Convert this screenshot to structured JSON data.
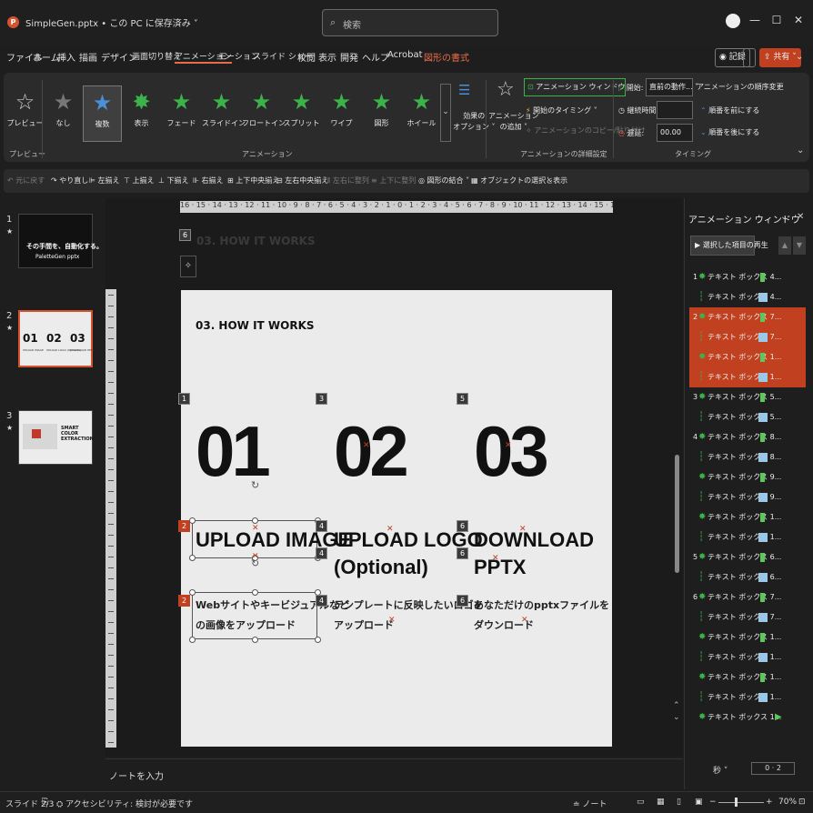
{
  "titlebar": {
    "filename": "SimpleGen.pptx",
    "save_status": "• この PC に保存済み ˅",
    "search_placeholder": "検索",
    "app_icon": "powerpoint-icon",
    "minimize": "—",
    "maximize": "☐",
    "close": "✕"
  },
  "menu": {
    "items": [
      "ファイル",
      "ホーム",
      "挿入",
      "描画",
      "デザイン",
      "画面切り替え",
      "アニメーション",
      "モーション",
      "スライド ショー",
      "校閲",
      "表示",
      "開発",
      "ヘルプ",
      "Acrobat",
      "図形の書式"
    ],
    "active_index": 6,
    "record": "記録",
    "share": "共有 ˅"
  },
  "ribbon": {
    "preview_label": "プレビュー",
    "preview_group": "プレビュー",
    "effects": [
      "なし",
      "複数",
      "表示",
      "フェード",
      "スライドイン",
      "フロートイン",
      "スプリット",
      "ワイプ",
      "図形",
      "ホイール"
    ],
    "selected_effect_index": 1,
    "animation_group": "アニメーション",
    "effect_options": "効果の\nオプション ˅",
    "add_animation": "アニメーション\nの追加 ˅",
    "animation_pane": "アニメーション ウィンドウ",
    "trigger": "開始のタイミング ˅",
    "painter": "アニメーションのコピー/貼り付け",
    "advanced_group": "アニメーションの詳細設定",
    "start_label": "開始:",
    "start_value": "直前の動作... ˅",
    "duration_label": "継続時間:",
    "duration_value": "",
    "delay_label": "遅延:",
    "delay_value": "00.00",
    "timing_group": "タイミング",
    "reorder_title": "アニメーションの順序変更",
    "move_earlier": "順番を前にする",
    "move_later": "順番を後にする"
  },
  "qat": {
    "items": [
      "元に戻す",
      "やり直し",
      "左揃え",
      "上揃え",
      "下揃え",
      "右揃え",
      "上下中央揃え",
      "左右中央揃え",
      "左右に整列",
      "上下に整列",
      "図形の結合 ˅",
      "オブジェクトの選択と表示"
    ],
    "disabled": [
      0,
      8,
      9
    ]
  },
  "thumbnails": [
    {
      "num": "1",
      "star": "★",
      "heading": "その手間を、自動化する。",
      "sub": "PaletteGen pptx"
    },
    {
      "num": "2",
      "star": "★",
      "cols": [
        "01",
        "02",
        "03"
      ],
      "captions": [
        "UPLOAD IMAGE",
        "UPLOAD LOGO (Optional)",
        "DOWNLOAD PPTX"
      ]
    },
    {
      "num": "3",
      "star": "★",
      "heading": "SMART COLOR EXTRACTION"
    }
  ],
  "ruler_ticks": "16 · 15 · 14 · 13 · 12 · 11 · 10 · 9 · 8 · 7 · 6 · 5 · 4 · 3 · 2 · 1 · 0 · 1 · 2 · 3 · 4 · 5 · 6 · 7 · 8 · 9 · 10 · 11 · 12 · 13 · 14 · 15 · 16",
  "offslide_title": "03. HOW IT WORKS",
  "offslide_tag": "6",
  "slide": {
    "title": "03. HOW IT WORKS",
    "columns": [
      {
        "num": "01",
        "heading1": "UPLOAD IMAGE",
        "heading2": "",
        "desc1": "Webサイトやキービジュアルなど",
        "desc2": "の画像をアップロード",
        "tag_num": "1",
        "tag_head": "2",
        "tag_desc": "2"
      },
      {
        "num": "02",
        "heading1": "UPLOAD LOGO",
        "heading2": "(Optional)",
        "desc1": "テンプレートに反映したいロゴを",
        "desc2": "アップロード",
        "tag_num": "3",
        "tag_head": "4",
        "tag_desc": "4"
      },
      {
        "num": "03",
        "heading1": "DOWNLOAD",
        "heading2": "PPTX",
        "desc1": "あなただけのpptxファイルを",
        "desc2": "ダウンロード",
        "tag_num": "5",
        "tag_head": "6",
        "tag_desc": "6"
      }
    ]
  },
  "notes_placeholder": "ノートを入力",
  "anim_pane": {
    "title": "アニメーション ウィンドウ",
    "play_button": "選択した項目の再生",
    "rows": [
      {
        "n": "1",
        "text": "テキスト ボックス 4...",
        "kind": "bar"
      },
      {
        "n": "",
        "text": "テキスト ボックス 4...",
        "kind": "box"
      },
      {
        "n": "2",
        "text": "テキスト ボックス 7...",
        "kind": "bar"
      },
      {
        "n": "",
        "text": "テキスト ボックス 7...",
        "kind": "box"
      },
      {
        "n": "",
        "text": "テキスト ボックス 1...",
        "kind": "bar"
      },
      {
        "n": "",
        "text": "テキスト ボックス 1...",
        "kind": "box"
      },
      {
        "n": "3",
        "text": "テキスト ボックス 5...",
        "kind": "bar"
      },
      {
        "n": "",
        "text": "テキスト ボックス 5...",
        "kind": "box"
      },
      {
        "n": "4",
        "text": "テキスト ボックス 8...",
        "kind": "bar"
      },
      {
        "n": "",
        "text": "テキスト ボックス 8...",
        "kind": "box"
      },
      {
        "n": "",
        "text": "テキスト ボックス 9...",
        "kind": "bar"
      },
      {
        "n": "",
        "text": "テキスト ボックス 9...",
        "kind": "box"
      },
      {
        "n": "",
        "text": "テキスト ボックス 1...",
        "kind": "bar"
      },
      {
        "n": "",
        "text": "テキスト ボックス 1...",
        "kind": "box"
      },
      {
        "n": "5",
        "text": "テキスト ボックス 6...",
        "kind": "bar"
      },
      {
        "n": "",
        "text": "テキスト ボックス 6...",
        "kind": "box"
      },
      {
        "n": "6",
        "text": "テキスト ボックス 7...",
        "kind": "bar"
      },
      {
        "n": "",
        "text": "テキスト ボックス 7...",
        "kind": "box"
      },
      {
        "n": "",
        "text": "テキスト ボックス 1...",
        "kind": "bar"
      },
      {
        "n": "",
        "text": "テキスト ボックス 1...",
        "kind": "box"
      },
      {
        "n": "",
        "text": "テキスト ボックス 1...",
        "kind": "bar"
      },
      {
        "n": "",
        "text": "テキスト ボックス 1...",
        "kind": "box"
      },
      {
        "n": "",
        "text": "テキスト ボックス 1...",
        "kind": "arrow"
      }
    ],
    "highlight_rows": [
      2,
      3,
      4,
      5
    ],
    "seconds_label": "秒 ˅",
    "timeline": "0 · 2"
  },
  "status": {
    "slide": "スライド 2/3",
    "accessibility": "アクセシビリティ: 検討が必要です",
    "notes": "ノート",
    "zoom": "70%"
  }
}
